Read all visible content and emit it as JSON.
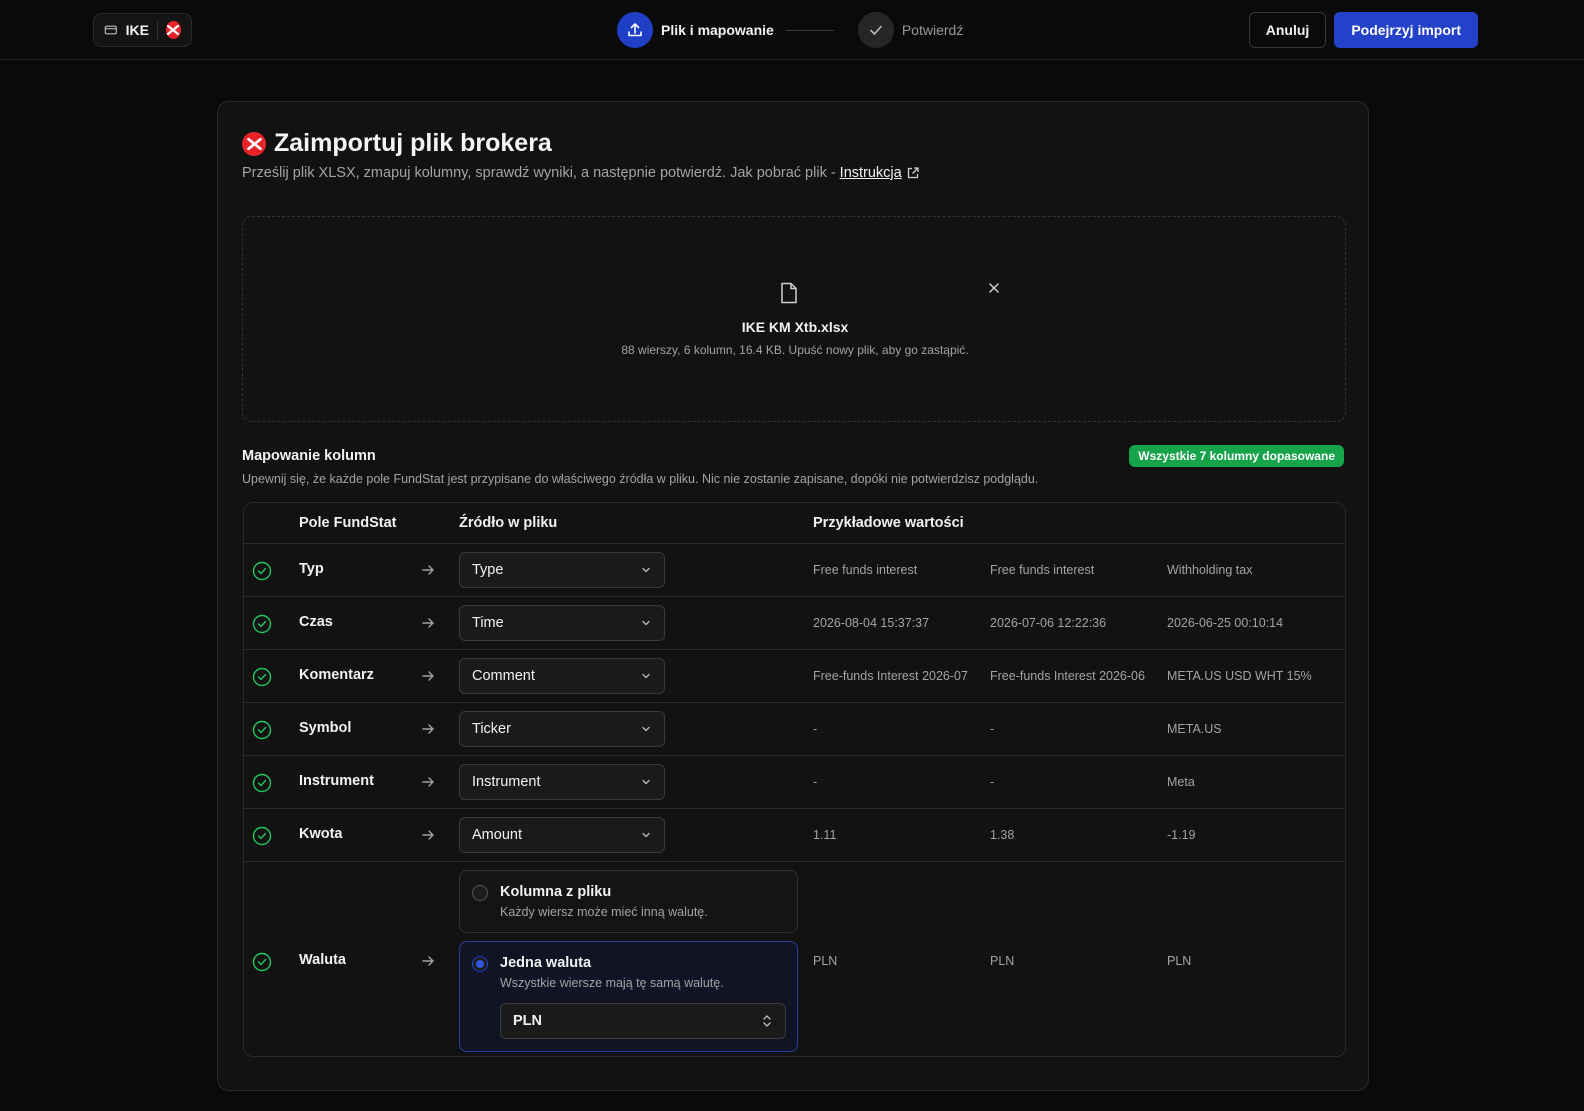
{
  "topbar": {
    "account_label": "IKE",
    "steps": [
      {
        "label": "Plik i mapowanie",
        "state": "active",
        "icon": "upload-icon"
      },
      {
        "label": "Potwierdź",
        "state": "pending",
        "icon": "check-icon"
      }
    ],
    "cancel_label": "Anuluj",
    "preview_label": "Podejrzyj import"
  },
  "card": {
    "title": "Zaimportuj plik brokera",
    "subtitle": "Prześlij plik XLSX, zmapuj kolumny, sprawdź wyniki, a następnie potwierdź. Jak pobrać plik -",
    "instruction_link": "Instrukcja"
  },
  "file": {
    "name": "IKE KM Xtb.xlsx",
    "meta": "88 wierszy, 6 kolumn, 16.4 KB. Upuść nowy plik, aby go zastąpić."
  },
  "mapping": {
    "title": "Mapowanie kolumn",
    "description": "Upewnij się, że każde pole FundStat jest przypisane do właściwego źródła w pliku. Nic nie zostanie zapisane, dopóki nie potwierdzisz podglądu.",
    "badge": "Wszystkie 7 kolumny dopasowane",
    "headers": {
      "field": "Pole FundStat",
      "source": "Źródło w pliku",
      "samples": "Przykładowe wartości"
    },
    "rows": [
      {
        "field": "Typ",
        "source": "Type",
        "samples": [
          "Free funds interest",
          "Free funds interest",
          "Withholding tax"
        ]
      },
      {
        "field": "Czas",
        "source": "Time",
        "samples": [
          "2026-08-04 15:37:37",
          "2026-07-06 12:22:36",
          "2026-06-25 00:10:14"
        ]
      },
      {
        "field": "Komentarz",
        "source": "Comment",
        "samples": [
          "Free-funds Interest 2026-07",
          "Free-funds Interest 2026-06",
          "META.US USD WHT 15%"
        ]
      },
      {
        "field": "Symbol",
        "source": "Ticker",
        "samples": [
          "-",
          "-",
          "META.US"
        ]
      },
      {
        "field": "Instrument",
        "source": "Instrument",
        "samples": [
          "-",
          "-",
          "Meta"
        ]
      },
      {
        "field": "Kwota",
        "source": "Amount",
        "samples": [
          "1.11",
          "1.38",
          "-1.19"
        ]
      }
    ],
    "currency_row": {
      "field": "Waluta",
      "option_column_title": "Kolumna z pliku",
      "option_column_desc": "Każdy wiersz może mieć inną walutę.",
      "option_single_title": "Jedna waluta",
      "option_single_desc": "Wszystkie wiersze mają tę samą walutę.",
      "selected_currency": "PLN",
      "samples": [
        "PLN",
        "PLN",
        "PLN"
      ]
    }
  },
  "colors": {
    "accent": "#2341c9",
    "success": "#16a34a",
    "broker": "#e8242b"
  }
}
